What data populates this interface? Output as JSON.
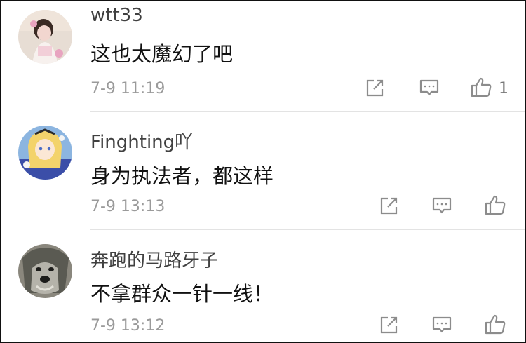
{
  "comments": [
    {
      "username": "wtt33",
      "text": "这也太魔幻了吧",
      "time": "7-9 11:19",
      "likes": "1",
      "avatar_colors": [
        "#d9c7b8",
        "#3a2a24",
        "#f2d6cf",
        "#e8a4c0"
      ]
    },
    {
      "username": "Finghting吖",
      "text": "身为执法者，都这样",
      "time": "7-9 13:13",
      "likes": "",
      "avatar_colors": [
        "#7fa9d8",
        "#f3d36b",
        "#fbe7d5",
        "#3b4ea8"
      ]
    },
    {
      "username": "奔跑的马路牙子",
      "text": "不拿群众一针一线！",
      "time": "7-9 13:12",
      "likes": "",
      "avatar_colors": [
        "#5a5a52",
        "#b5b3aa",
        "#1c1c1a",
        "#e2e0d8"
      ]
    }
  ],
  "icons": {
    "share": "share-icon",
    "reply": "reply-icon",
    "like": "thumbs-up-icon"
  },
  "colors": {
    "icon": "#8c8c8c",
    "username": "#404040",
    "text": "#111111",
    "meta": "#9a9a9a"
  }
}
